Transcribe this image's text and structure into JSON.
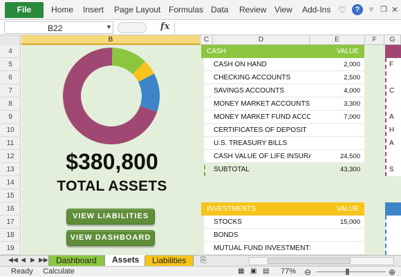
{
  "ribbon": {
    "file_label": "File",
    "tabs": [
      "Home",
      "Insert",
      "Page Layout",
      "Formulas",
      "Data",
      "Review",
      "View",
      "Add-Ins"
    ],
    "help_label": "?",
    "icons": [
      "heart-icon",
      "help-icon",
      "restore-icon",
      "minimize-icon",
      "close-icon"
    ]
  },
  "formula_bar": {
    "name_box": "B22",
    "fx_label": "fx",
    "value": ""
  },
  "columns": {
    "labels": [
      "B",
      "C",
      "D",
      "E",
      "F",
      "G"
    ],
    "selected": "B"
  },
  "rows": [
    "4",
    "5",
    "6",
    "7",
    "8",
    "9",
    "10",
    "11",
    "12",
    "13",
    "14",
    "15",
    "16",
    "17",
    "18",
    "19"
  ],
  "summary": {
    "total_amount": "$380,800",
    "total_label": "TOTAL ASSETS",
    "btn_liabilities": "VIEW LIABILITIES",
    "btn_dashboard": "VIEW DASHBOARD"
  },
  "donut": {
    "colors": {
      "green": "#8cc63f",
      "yellow": "#f6c41a",
      "blue": "#3d85c8",
      "purple": "#a04873"
    },
    "segments": [
      {
        "color": "#8cc63f",
        "fraction": 0.12
      },
      {
        "color": "#f6c41a",
        "fraction": 0.05
      },
      {
        "color": "#3d85c8",
        "fraction": 0.13
      },
      {
        "color": "#a04873",
        "fraction": 0.7
      }
    ]
  },
  "cash_table": {
    "header": "CASH",
    "value_header": "VALUE",
    "header_color": "#8cc63f",
    "rows": [
      {
        "label": "CASH ON HAND",
        "value": "2,000"
      },
      {
        "label": "CHECKING ACCOUNTS",
        "value": "2,500"
      },
      {
        "label": "SAVINGS ACCOUNTS",
        "value": "4,000"
      },
      {
        "label": "MONEY MARKET ACCOUNTS",
        "value": "3,300"
      },
      {
        "label": "MONEY MARKET FUND ACCO",
        "value": "7,000"
      },
      {
        "label": "CERTIFICATES OF DEPOSIT",
        "value": ""
      },
      {
        "label": "U.S. TREASURY BILLS",
        "value": ""
      },
      {
        "label": "CASH VALUE OF LIFE INSURAN",
        "value": "24,500"
      },
      {
        "label": "SUBTOTAL",
        "value": "43,300"
      }
    ]
  },
  "investments_table": {
    "header": "INVESTMENTS",
    "value_header": "VALUE",
    "header_color": "#f6c41a",
    "rows": [
      {
        "label": "STOCKS",
        "value": "15,000"
      },
      {
        "label": "BONDS",
        "value": ""
      },
      {
        "label": "MUTUAL FUND INVESTMENTS",
        "value": ""
      }
    ]
  },
  "side_panel": {
    "top_color": "#a04873",
    "bottom_color": "#3d85c8",
    "letters": [
      "F",
      "C",
      "A",
      "H",
      "A",
      "S"
    ]
  },
  "sheet_tabs": [
    {
      "label": "Dashboard",
      "color": "#8cc63f",
      "active": false
    },
    {
      "label": "Assets",
      "color": "#ffffff",
      "active": true
    },
    {
      "label": "Liabilities",
      "color": "#f6c41a",
      "active": false
    }
  ],
  "status": {
    "ready": "Ready",
    "calculate": "Calculate",
    "zoom": "77%"
  }
}
